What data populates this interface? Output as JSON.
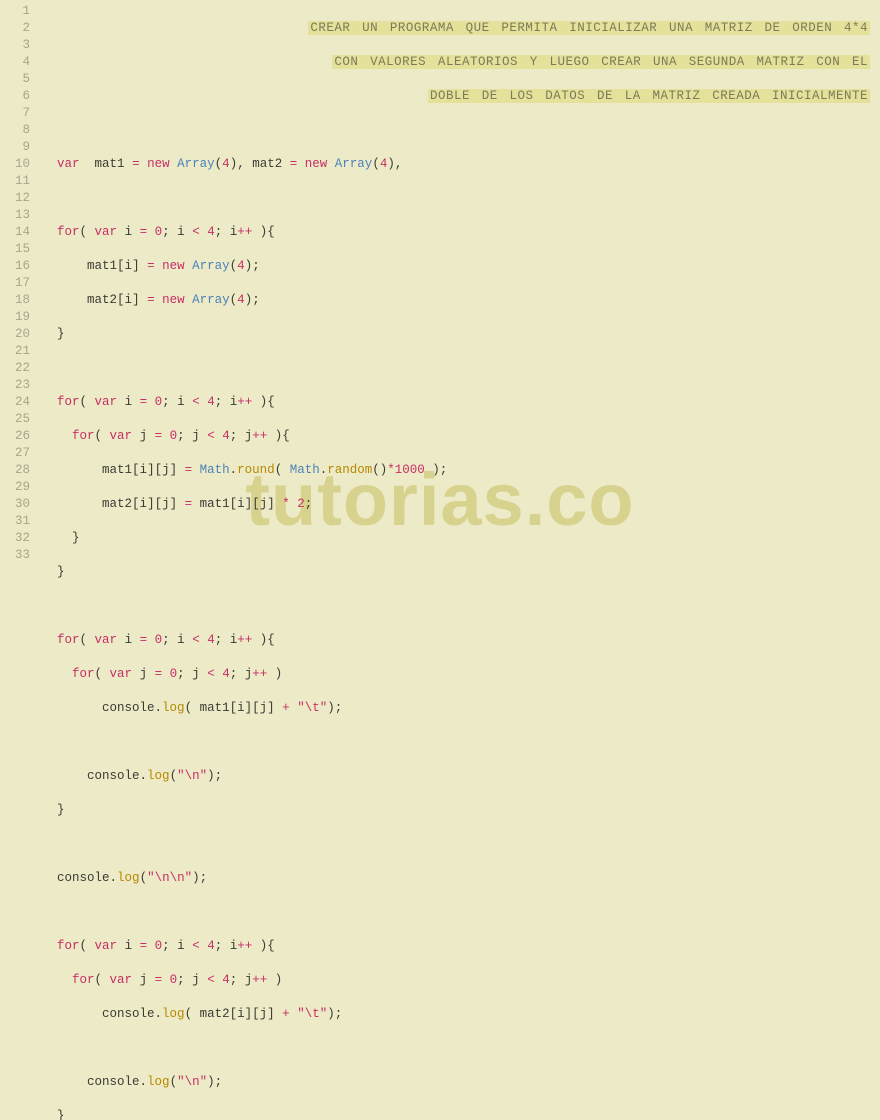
{
  "watermark": "tutorias.co",
  "gutter": {
    "start": 1,
    "end": 33
  },
  "comment": {
    "l1": "CREAR UN PROGRAMA QUE PERMITA INICIALIZAR UNA MATRIZ DE ORDEN 4*4",
    "l2": "CON VALORES ALEATORIOS Y LUEGO CREAR UNA SEGUNDA MATRIZ CON EL",
    "l3": "DOBLE DE LOS DATOS DE LA MATRIZ CREADA INICIALMENTE"
  },
  "kw": {
    "var": "var",
    "new": "new",
    "for": "for"
  },
  "cls": {
    "Array": "Array",
    "Math": "Math"
  },
  "fn": {
    "round": "round",
    "random": "random",
    "log": "log"
  },
  "id": {
    "mat1": "mat1",
    "mat2": "mat2",
    "i": "i",
    "j": "j",
    "console": "console"
  },
  "num": {
    "n4": "4",
    "n0": "0",
    "n1000": "1000",
    "n2": "2"
  },
  "str": {
    "tab": "\"\\t\"",
    "nl": "\"\\n\"",
    "nlnl": "\"\\n\\n\""
  }
}
